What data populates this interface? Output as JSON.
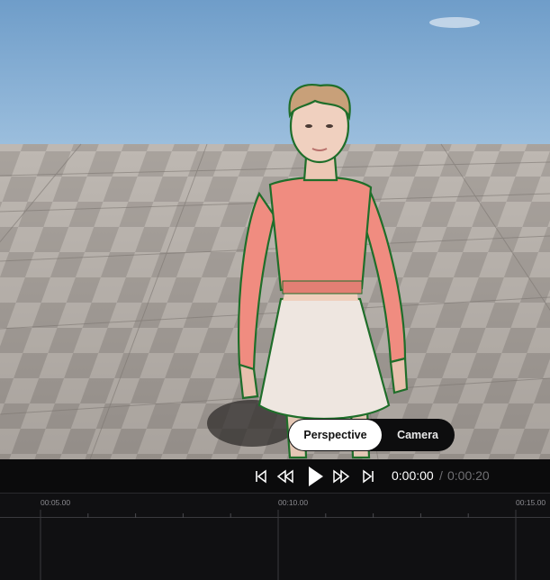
{
  "viewport": {
    "mode_toggle": {
      "active_label": "Perspective",
      "inactive_label": "Camera"
    }
  },
  "playback": {
    "current_time": "0:00:00",
    "separator": "/",
    "total_time": "0:00:20",
    "icons": [
      "skip-to-start-icon",
      "rewind-icon",
      "play-icon",
      "fast-forward-icon",
      "skip-to-end-icon"
    ]
  },
  "timeline": {
    "markers": [
      "00:05.00",
      "00:10.00",
      "00:15.00"
    ]
  },
  "colors": {
    "sky": "#7ea8d0",
    "background": "#0b0b0c",
    "toggle_active": "#ffffff",
    "outline": "#1f6e2a",
    "sweater": "#f08c80",
    "skirt": "#eee6e0"
  }
}
